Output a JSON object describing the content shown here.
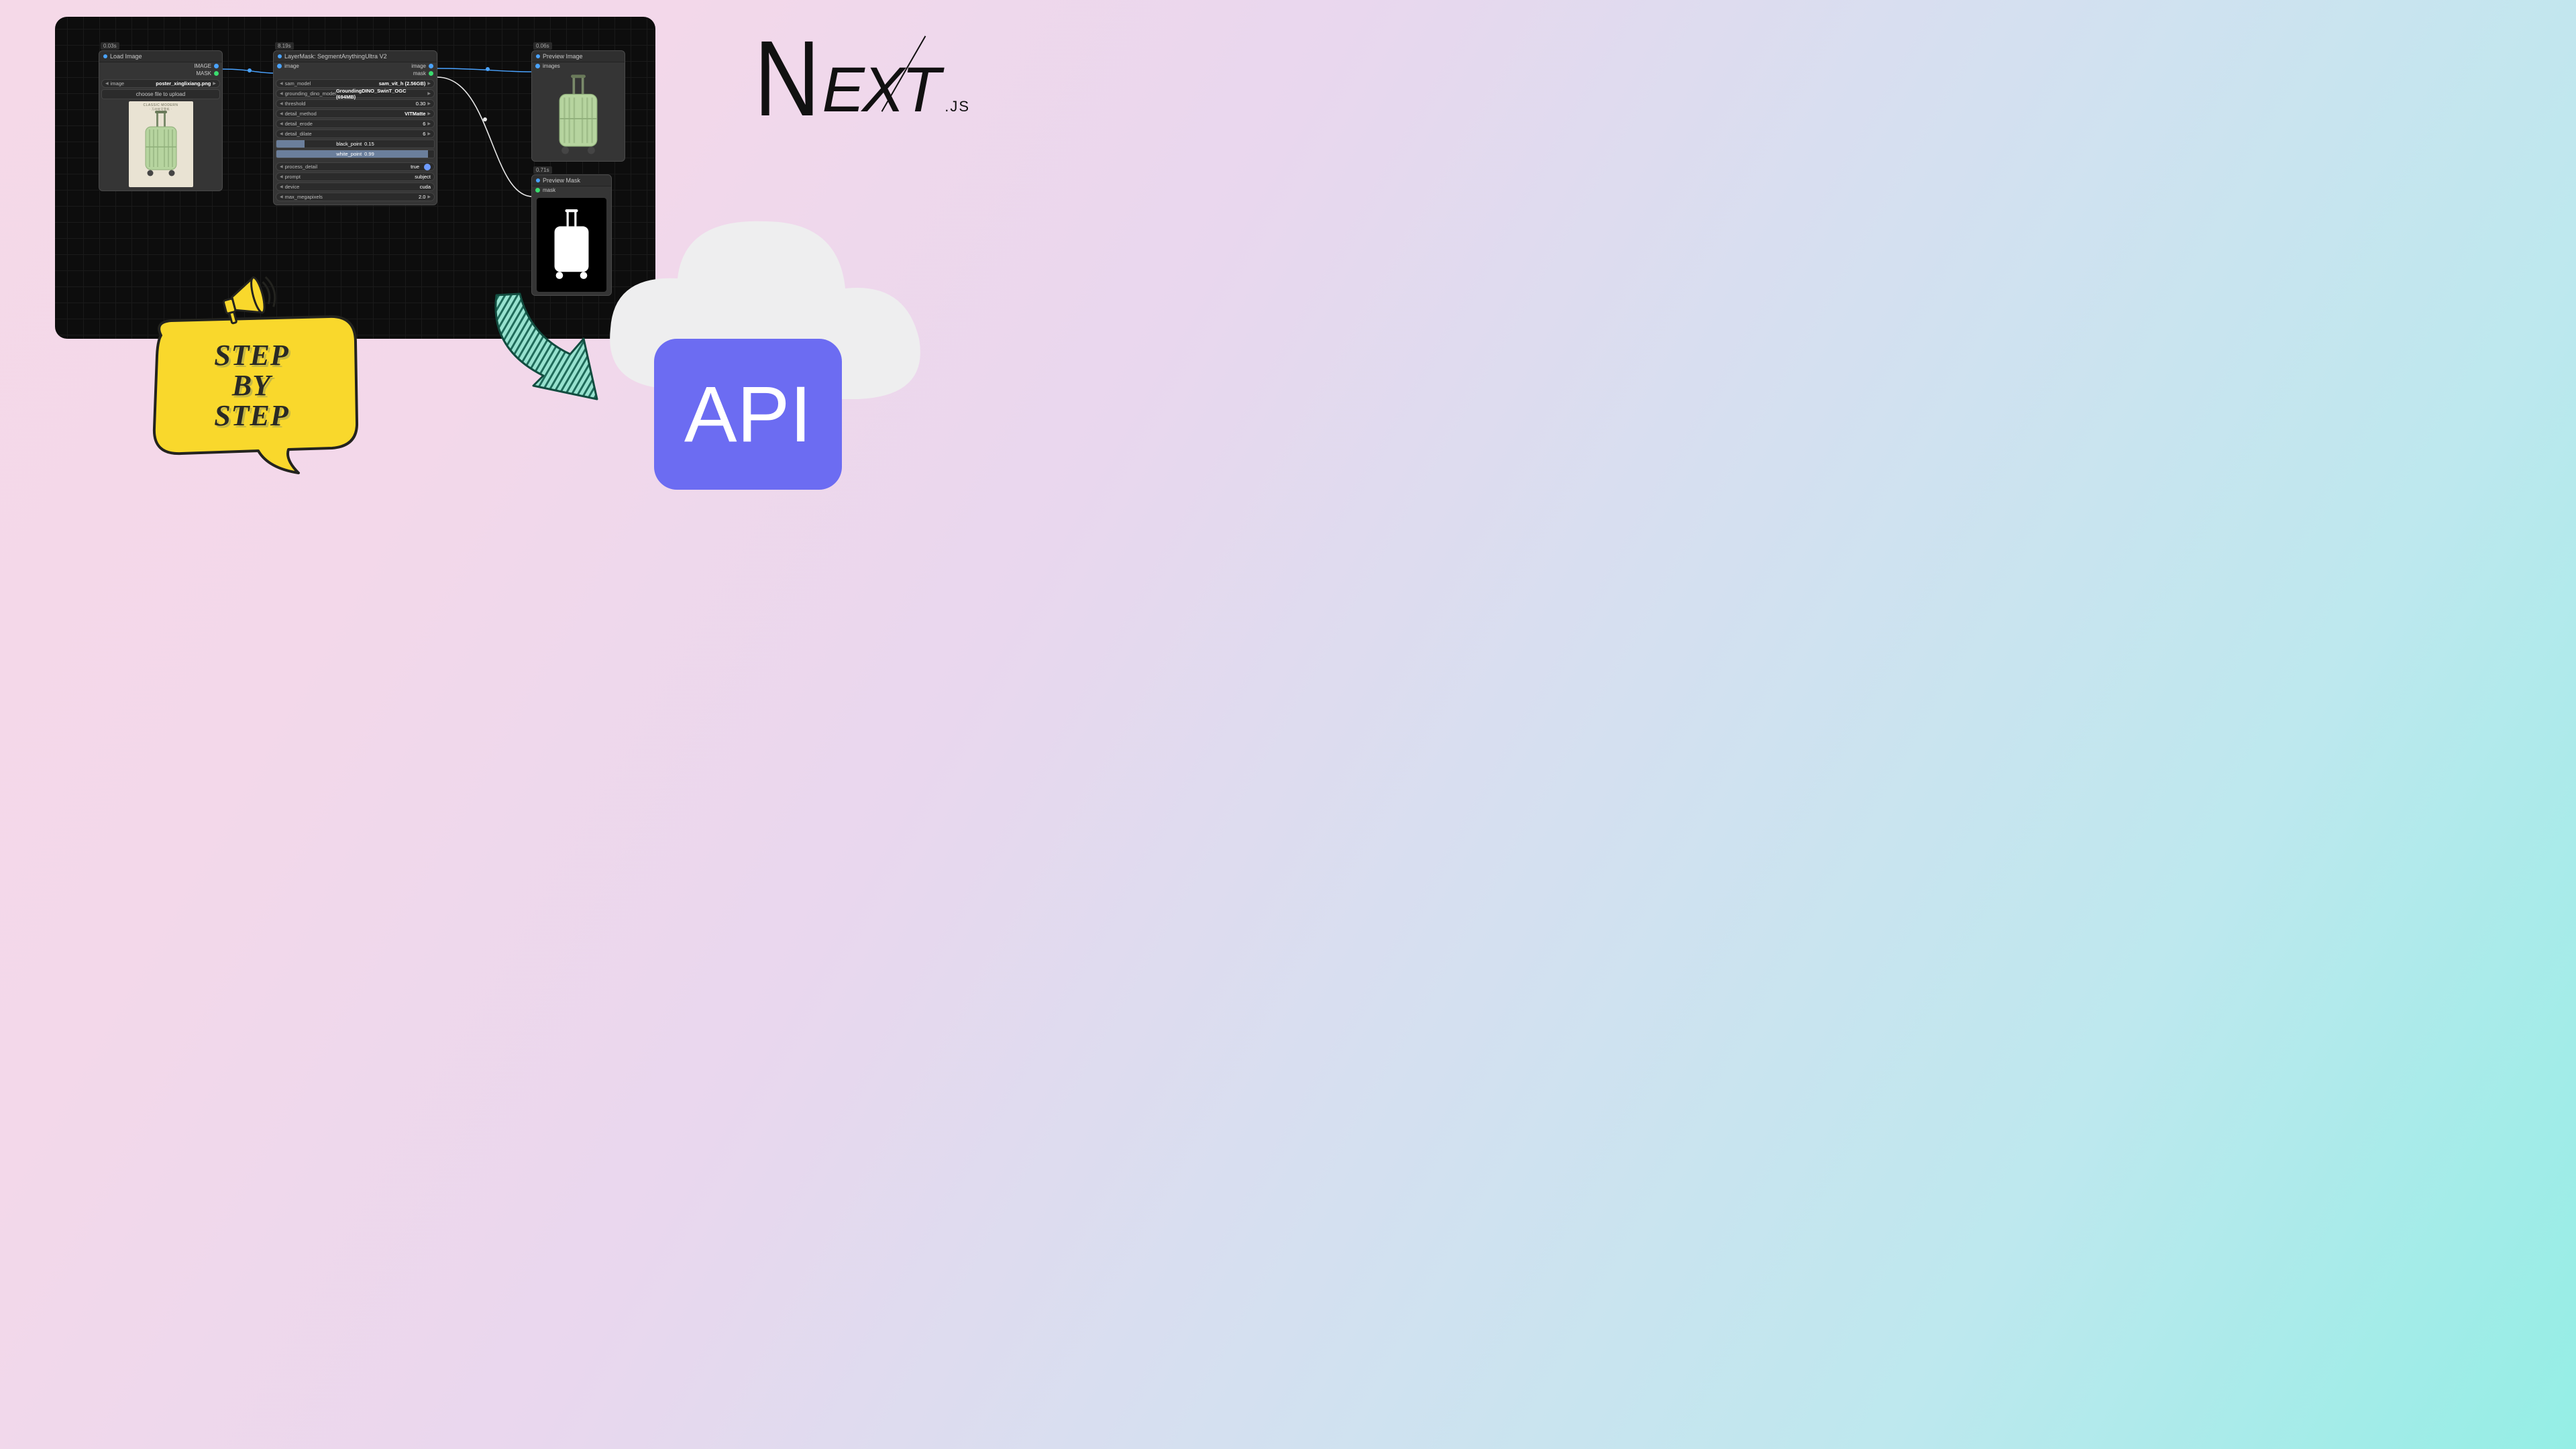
{
  "nodes": {
    "load": {
      "timer": "0.03s",
      "title": "Load Image",
      "out_image": "IMAGE",
      "out_mask": "MASK",
      "param_image_label": "image",
      "param_image_value": "poster_xinglixiang.png",
      "choose_file": "choose file to upload",
      "preview_caption": "CLASSIC MODERN"
    },
    "layer": {
      "timer": "8.19s",
      "title": "LayerMask: SegmentAnythingUltra V2",
      "in_image": "image",
      "out_image": "image",
      "out_mask": "mask",
      "rows": [
        {
          "label": "sam_model",
          "value": "sam_vit_h (2.56GB)"
        },
        {
          "label": "grounding_dino_model",
          "value": "GroundingDINO_SwinT_OGC (694MB)"
        },
        {
          "label": "threshold",
          "value": "0.30"
        },
        {
          "label": "detail_method",
          "value": "VITMatte"
        },
        {
          "label": "detail_erode",
          "value": "6"
        },
        {
          "label": "detail_dilate",
          "value": "6"
        }
      ],
      "sliders": [
        {
          "label": "black_point",
          "value": "0.15",
          "pct": 18
        },
        {
          "label": "white_point",
          "value": "0.99",
          "pct": 96
        }
      ],
      "rows2": [
        {
          "label": "process_detail",
          "value": "true",
          "toggle": true
        },
        {
          "label": "prompt",
          "value": "subject"
        },
        {
          "label": "device",
          "value": "cuda"
        },
        {
          "label": "max_megapixels",
          "value": "2.0"
        }
      ]
    },
    "previewI": {
      "timer": "0.06s",
      "title": "Preview Image",
      "in": "images"
    },
    "previewM": {
      "timer": "0.71s",
      "title": "Preview Mask",
      "in": "mask"
    }
  },
  "overlays": {
    "next_main": "EXT",
    "next_js": ".JS",
    "bubble_line1": "STEP",
    "bubble_line2": "BY",
    "bubble_line3": "STEP",
    "api": "API"
  }
}
